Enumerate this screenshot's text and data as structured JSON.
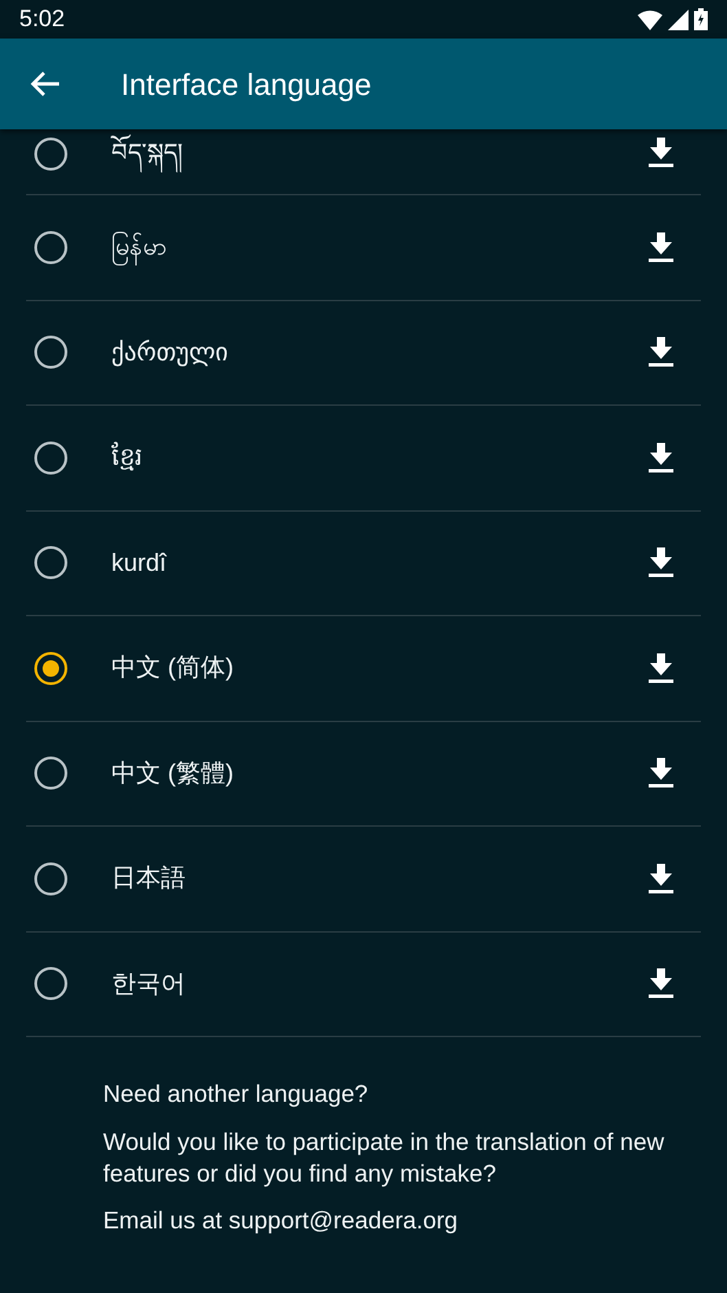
{
  "status_bar": {
    "time": "5:02"
  },
  "app_bar": {
    "title": "Interface language"
  },
  "languages": [
    {
      "label": "བོད་སྐད།",
      "selected": false
    },
    {
      "label": "မြန်မာ",
      "selected": false
    },
    {
      "label": "ქართული",
      "selected": false
    },
    {
      "label": "ខ្មែរ",
      "selected": false
    },
    {
      "label": "kurdî",
      "selected": false
    },
    {
      "label": "中文 (简体)",
      "selected": true
    },
    {
      "label": "中文 (繁體)",
      "selected": false
    },
    {
      "label": "日本語",
      "selected": false
    },
    {
      "label": "한국어",
      "selected": false
    }
  ],
  "footer": {
    "heading": "Need another language?",
    "text": "Would you like to participate in the translation of new features or did you find any mistake?",
    "email": "Email us at support@readera.org"
  }
}
